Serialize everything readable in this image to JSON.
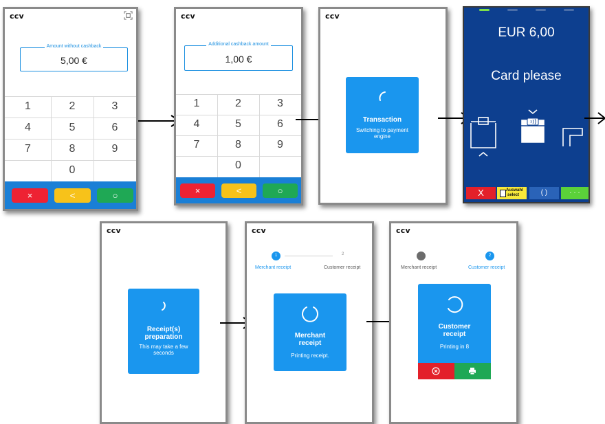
{
  "brand": "ccv",
  "screen1": {
    "field_label": "Amount without cashback",
    "value": "5,00 €",
    "keys": [
      "1",
      "2",
      "3",
      "4",
      "5",
      "6",
      "7",
      "8",
      "9",
      "0"
    ],
    "buttons": {
      "cancel": "×",
      "back": "<",
      "ok": "○"
    }
  },
  "screen2": {
    "field_label": "Additional cashback amount",
    "value": "1,00 €",
    "keys": [
      "1",
      "2",
      "3",
      "4",
      "5",
      "6",
      "7",
      "8",
      "9",
      "0"
    ],
    "buttons": {
      "cancel": "×",
      "back": "<",
      "ok": "○"
    }
  },
  "screen3": {
    "card_title": "Transaction",
    "card_sub": "Switching to payment engine"
  },
  "terminal": {
    "amount": "EUR 6,00",
    "prompt": "Card please",
    "buttons": {
      "cancel": "X",
      "select_line1": "Auswahl",
      "select_line2": "select",
      "refresh": "( )",
      "more": "· · ·"
    }
  },
  "screen5": {
    "card_title": "Receipt(s) preparation",
    "card_sub": "This may take a few seconds"
  },
  "screen6": {
    "step1_num": "1",
    "step2_num": "2",
    "step1_label": "Merchant receipt",
    "step2_label": "Customer receipt",
    "card_title": "Merchant receipt",
    "card_sub": "Printing receipt."
  },
  "screen7": {
    "step2_num": "2",
    "step1_label": "Merchant receipt",
    "step2_label": "Customer receipt",
    "card_title": "Customer receipt",
    "card_sub": "Printing in 8"
  },
  "colors": {
    "accent": "#1a96ee",
    "bar": "#1a7fd6",
    "red": "#ee2233",
    "yellow": "#f7c21a",
    "green": "#1fa855",
    "terminal_bg": "#0d3f8f"
  }
}
